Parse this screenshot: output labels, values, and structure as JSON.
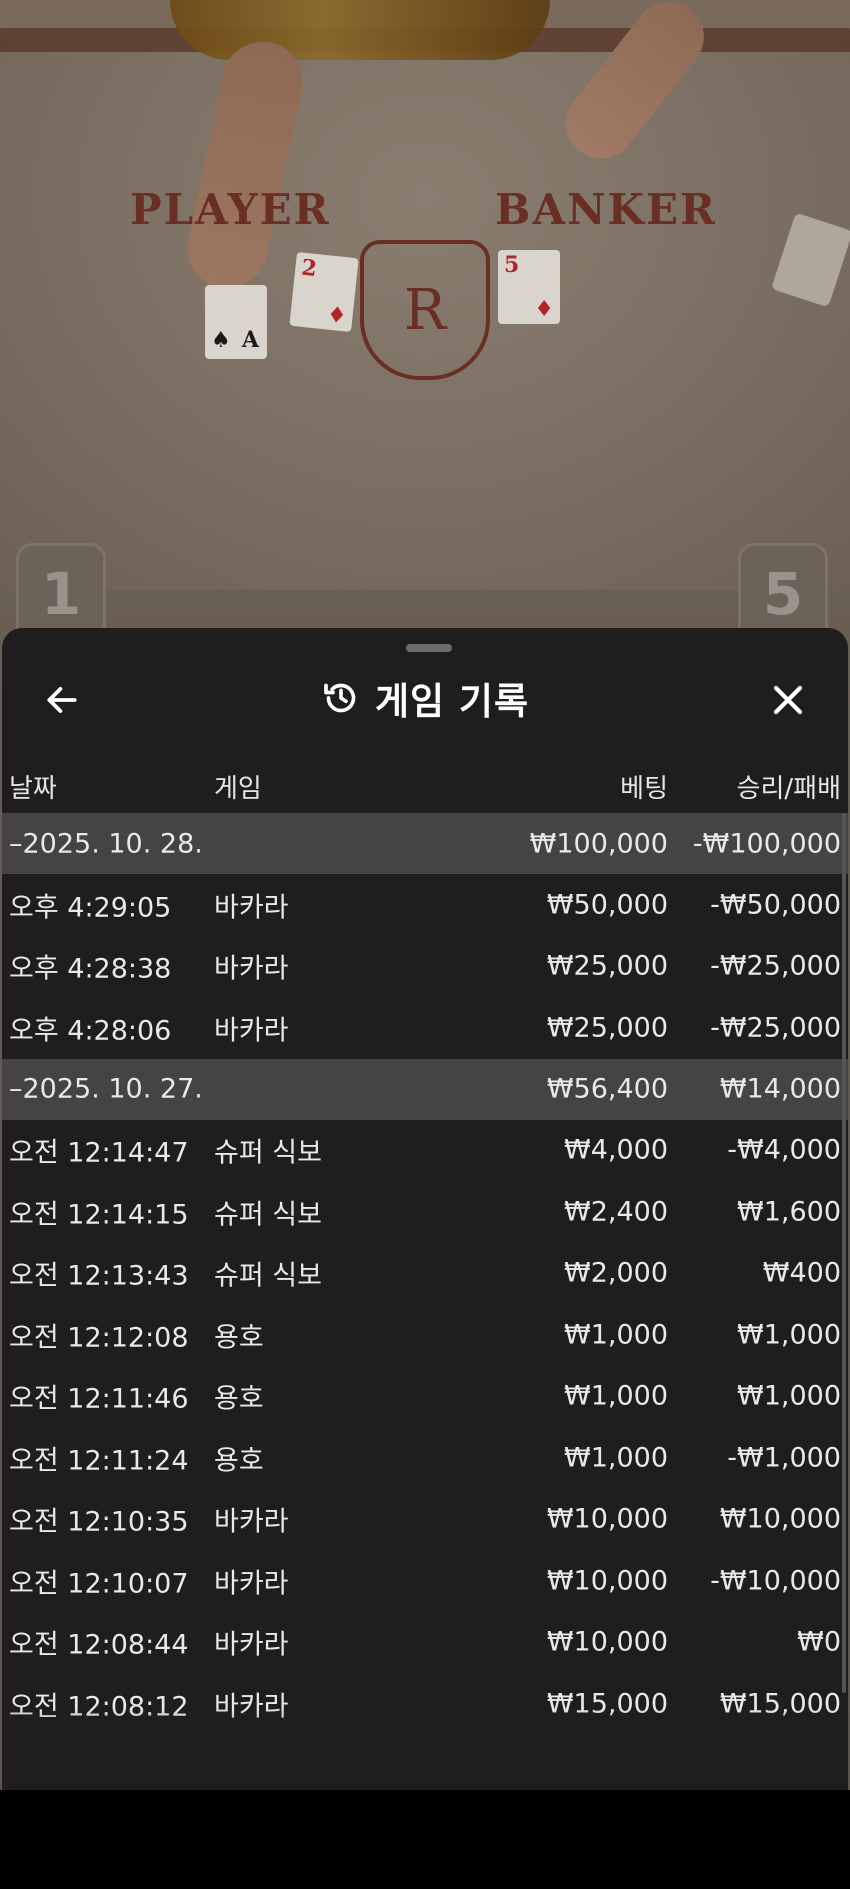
{
  "table": {
    "player_label": "PLAYER",
    "banker_label": "BANKER",
    "crest_letter": "R",
    "player_card_1": {
      "rank": "A",
      "suit": "♠"
    },
    "player_card_2": {
      "rank": "2",
      "suit": "♦"
    },
    "banker_card_1": {
      "rank": "5",
      "suit": "♦"
    },
    "seat_left": "1",
    "seat_right": "5"
  },
  "sheet": {
    "title": "게임 기록",
    "icons": {
      "back": "arrow-left-icon",
      "history": "history-icon",
      "close": "close-icon"
    },
    "columns": {
      "date": "날짜",
      "game": "게임",
      "bet": "베팅",
      "win": "승리/패배"
    },
    "rows": [
      {
        "type": "group",
        "date": "–2025. 10. 28.",
        "game": "",
        "bet": "₩100,000",
        "win": "-₩100,000"
      },
      {
        "type": "item",
        "date": "오후 4:29:05",
        "game": "바카라",
        "bet": "₩50,000",
        "win": "-₩50,000"
      },
      {
        "type": "item",
        "date": "오후 4:28:38",
        "game": "바카라",
        "bet": "₩25,000",
        "win": "-₩25,000"
      },
      {
        "type": "item",
        "date": "오후 4:28:06",
        "game": "바카라",
        "bet": "₩25,000",
        "win": "-₩25,000"
      },
      {
        "type": "group",
        "date": "–2025. 10. 27.",
        "game": "",
        "bet": "₩56,400",
        "win": "₩14,000"
      },
      {
        "type": "item",
        "date": "오전 12:14:47",
        "game": "슈퍼 식보",
        "bet": "₩4,000",
        "win": "-₩4,000"
      },
      {
        "type": "item",
        "date": "오전 12:14:15",
        "game": "슈퍼 식보",
        "bet": "₩2,400",
        "win": "₩1,600"
      },
      {
        "type": "item",
        "date": "오전 12:13:43",
        "game": "슈퍼 식보",
        "bet": "₩2,000",
        "win": "₩400"
      },
      {
        "type": "item",
        "date": "오전 12:12:08",
        "game": "용호",
        "bet": "₩1,000",
        "win": "₩1,000"
      },
      {
        "type": "item",
        "date": "오전 12:11:46",
        "game": "용호",
        "bet": "₩1,000",
        "win": "₩1,000"
      },
      {
        "type": "item",
        "date": "오전 12:11:24",
        "game": "용호",
        "bet": "₩1,000",
        "win": "-₩1,000"
      },
      {
        "type": "item",
        "date": "오전 12:10:35",
        "game": "바카라",
        "bet": "₩10,000",
        "win": "₩10,000"
      },
      {
        "type": "item",
        "date": "오전 12:10:07",
        "game": "바카라",
        "bet": "₩10,000",
        "win": "-₩10,000"
      },
      {
        "type": "item",
        "date": "오전 12:08:44",
        "game": "바카라",
        "bet": "₩10,000",
        "win": "₩0"
      },
      {
        "type": "item",
        "date": "오전 12:08:12",
        "game": "바카라",
        "bet": "₩15,000",
        "win": "₩15,000"
      }
    ]
  }
}
